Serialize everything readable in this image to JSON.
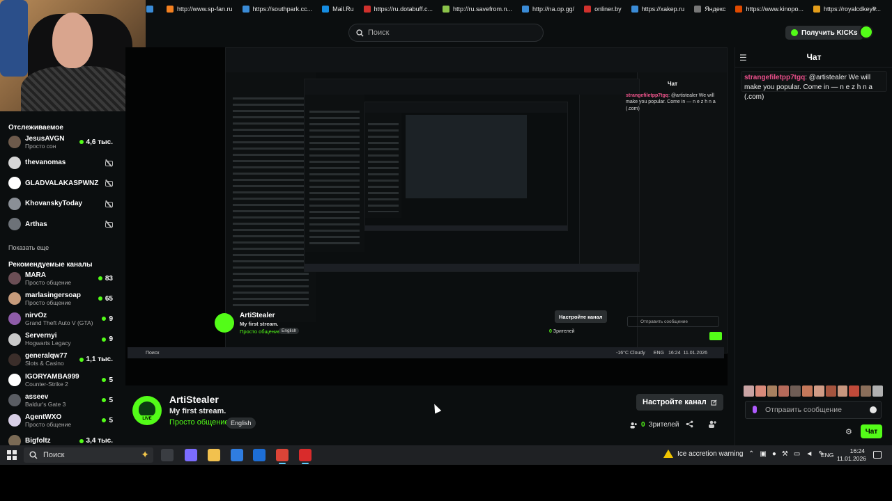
{
  "bookmarks": [
    {
      "label": "",
      "color": "#3a8bd6"
    },
    {
      "label": "http://www.sp-fan.ru",
      "color": "#f38020"
    },
    {
      "label": "https://southpark.cc...",
      "color": "#3a8bd6"
    },
    {
      "label": "Mail.Ru",
      "color": "#168de2"
    },
    {
      "label": "https://ru.dotabuff.c...",
      "color": "#d0312d"
    },
    {
      "label": "http://ru.savefrom.n...",
      "color": "#8bc34a"
    },
    {
      "label": "http://na.op.gg/",
      "color": "#3a8bd6"
    },
    {
      "label": "onliner.by",
      "color": "#d0312d"
    },
    {
      "label": "https://xakep.ru",
      "color": "#3a8bd6"
    },
    {
      "label": "Яндекс",
      "color": "#777"
    },
    {
      "label": "https://www.kinopo...",
      "color": "#e04a00"
    },
    {
      "label": "https://royalcdkeys...",
      "color": "#e39d1a"
    }
  ],
  "bookmarks_more": "»",
  "header": {
    "search_placeholder": "Поиск",
    "kicks_button": "Получить KICKs"
  },
  "sidebar": {
    "following_title": "Отслеживаемое",
    "following": [
      {
        "name": "JesusAVGN",
        "sub": "Просто сон",
        "count": "4,6 тыс.",
        "live": true,
        "avatar": "#6d5a4b"
      },
      {
        "name": "thevanomas",
        "sub": "",
        "count": "",
        "live": false,
        "avatar": "#d6d6d6"
      },
      {
        "name": "GLADVALAKASPWNZ",
        "sub": "",
        "count": "",
        "live": false,
        "avatar": "#ffffff"
      },
      {
        "name": "KhovanskyToday",
        "sub": "",
        "count": "",
        "live": false,
        "avatar": "#8a8f96"
      },
      {
        "name": "Arthas",
        "sub": "",
        "count": "",
        "live": false,
        "avatar": "#6d7278"
      }
    ],
    "show_more": "Показать еще",
    "recommended_title": "Рекомендуемые каналы",
    "recommended": [
      {
        "name": "MARA",
        "sub": "Просто общение",
        "count": "83",
        "avatar": "#6b4e55"
      },
      {
        "name": "marlasingersoap",
        "sub": "Просто общение",
        "count": "65",
        "avatar": "#c69b7b"
      },
      {
        "name": "nirvOz",
        "sub": "Grand Theft Auto V (GTA)",
        "count": "9",
        "avatar": "#8e5ba8"
      },
      {
        "name": "Servernyi",
        "sub": "Hogwarts Legacy",
        "count": "9",
        "avatar": "#c9c9c9"
      },
      {
        "name": "generalqw77",
        "sub": "Slots & Casino",
        "count": "1,1 тыс.",
        "avatar": "#3b2e2a"
      },
      {
        "name": "IGORYAMBA999",
        "sub": "Counter-Strike 2",
        "count": "5",
        "avatar": "#ffffff"
      },
      {
        "name": "asseev",
        "sub": "Baldur's Gate 3",
        "count": "5",
        "avatar": "#5a5d63"
      },
      {
        "name": "AgentWXO",
        "sub": "Просто общение",
        "count": "5",
        "avatar": "#d8cfe6"
      },
      {
        "name": "Bigfoltz",
        "sub": "",
        "count": "3,4 тыс.",
        "avatar": "#7a6a55"
      }
    ]
  },
  "stream_inner": {
    "streamer": "ArtiStealer",
    "title": "My first stream.",
    "category": "Просто общение",
    "language": "English",
    "configure_button": "Настройте канал",
    "viewers_count": "0",
    "viewers_label": "Зрителей",
    "chat_title": "Чат",
    "chat_user": "strangefiletpp7tgq",
    "chat_text": "@artistealer We will make you popular. Come in — n e z h n a (.com)",
    "chat_placeholder": "Отправить сообщение",
    "taskbar_search": "Поиск",
    "weather": "-16°C Cloudy",
    "lang": "ENG",
    "time": "16:24",
    "date": "11.01.2026"
  },
  "channel": {
    "name": "ArtiStealer",
    "live_badge": "LIVE",
    "title": "My first stream.",
    "category": "Просто общение",
    "language": "English",
    "configure_button": "Настройте канал",
    "viewers_count": "0",
    "viewers_label": "Зрителей"
  },
  "chat": {
    "title": "Чат",
    "message_user": "strangefiletpp7tgq",
    "message_text": ": @artistealer We will make you popular. Come in — n e z h n a (.com)",
    "input_placeholder": "Отправить сообщение",
    "send_button": "Чат",
    "emote_colors": [
      "#c9a3a3",
      "#d98a7a",
      "#a8805f",
      "#b56a5a",
      "#6f5d55",
      "#c4785a",
      "#d19c86",
      "#a5543e",
      "#c8967e",
      "#c04a3a",
      "#8a6e5a",
      "#b0b0b0"
    ]
  },
  "taskbar": {
    "search_placeholder": "Поиск",
    "warning_text": "Ice accretion warning",
    "lang": "ENG",
    "time": "16:24",
    "date": "11.01.2026",
    "apps": [
      {
        "name": "task-view-app",
        "color": "#3a3d42"
      },
      {
        "name": "copilot-app",
        "color": "#7b6cff"
      },
      {
        "name": "file-explorer-app",
        "color": "#f2c14e"
      },
      {
        "name": "store-app",
        "color": "#2f7de1"
      },
      {
        "name": "outlook-app",
        "color": "#1d6ed6"
      },
      {
        "name": "chrome-app",
        "color": "#dc4437"
      },
      {
        "name": "obs-app",
        "color": "#d92b2b"
      }
    ]
  }
}
